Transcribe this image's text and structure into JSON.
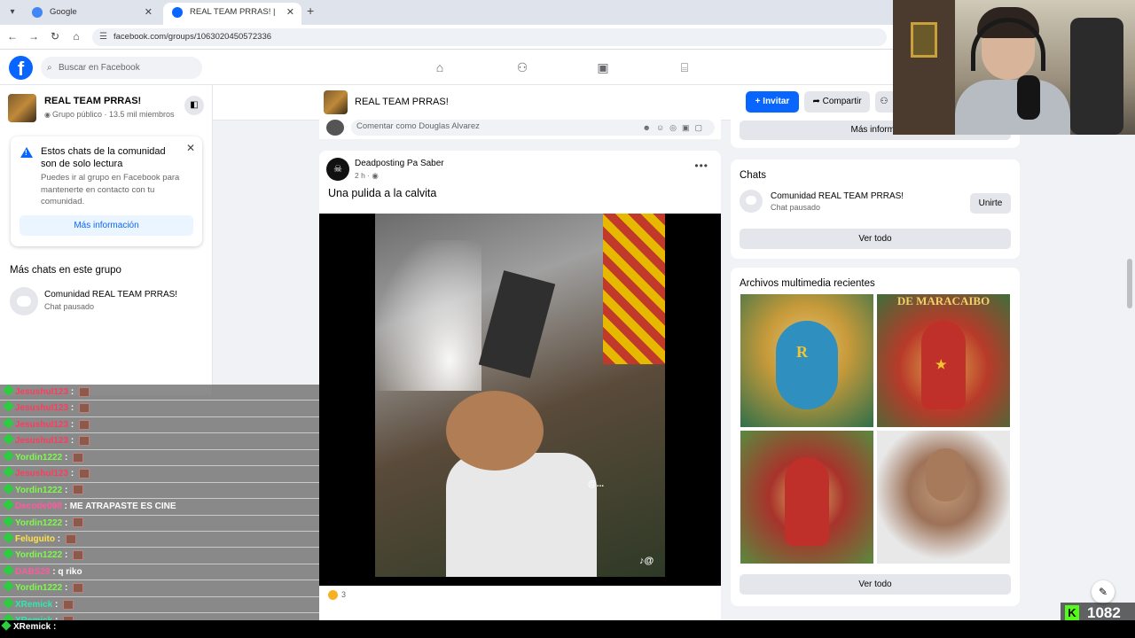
{
  "browser": {
    "tabs": [
      {
        "title": "Google",
        "favicon_color": "#4285f4"
      },
      {
        "title": "REAL TEAM PRRAS! | Facebook",
        "favicon_color": "#0866ff"
      }
    ],
    "new_tab": "+",
    "url": "facebook.com/groups/1063020450572336"
  },
  "facebook": {
    "logo": "f",
    "search_placeholder": "Buscar en Facebook",
    "nav_icons": [
      "home-icon",
      "friends-icon",
      "watch-icon",
      "marketplace-icon"
    ]
  },
  "sidebar": {
    "group_name": "REAL TEAM PRRAS!",
    "group_meta": "Grupo público · 13.5 mil miembros",
    "notice": {
      "title": "Estos chats de la comunidad son de solo lectura",
      "body": "Puedes ir al grupo en Facebook para mantenerte en contacto con tu comunidad.",
      "button": "Más información"
    },
    "more_chats_heading": "Más chats en este grupo",
    "chat": {
      "name": "Comunidad REAL TEAM PRRAS!",
      "status": "Chat pausado"
    }
  },
  "group_header": {
    "name": "REAL TEAM PRRAS!",
    "invite": "Invitar",
    "share": "Compartir"
  },
  "comment_box": {
    "placeholder": "Comentar como Douglas Alvarez"
  },
  "post": {
    "author": "Deadposting Pa Saber",
    "time": "2 h · ",
    "text": "Una pulida a la calvita",
    "video_watermark": "@...",
    "reactions": "3"
  },
  "right": {
    "top_button": "Más informa",
    "chats_title": "Chats",
    "chat": {
      "name": "Comunidad REAL TEAM PRRAS!",
      "status": "Chat pausado",
      "join": "Unirte"
    },
    "see_all": "Ver todo",
    "media_title": "Archivos multimedia recientes",
    "media": [
      {
        "caption": "",
        "emblem": "R"
      },
      {
        "caption": "DE MARACAIBO",
        "emblem": "★"
      },
      {
        "caption": "",
        "emblem": ""
      },
      {
        "caption": "",
        "emblem": ""
      }
    ],
    "media_see_all": "Ver todo"
  },
  "twitch_chat": [
    {
      "user": "Jesushul123",
      "color": "#ff3b5c",
      "message": ""
    },
    {
      "user": "Jesushul123",
      "color": "#ff3b5c",
      "message": ""
    },
    {
      "user": "Jesushul123",
      "color": "#ff3b5c",
      "message": ""
    },
    {
      "user": "Jesushul123",
      "color": "#ff3b5c",
      "message": ""
    },
    {
      "user": "Yordin1222",
      "color": "#7cfc4a",
      "message": ""
    },
    {
      "user": "Jesushul123",
      "color": "#ff3b5c",
      "message": ""
    },
    {
      "user": "Yordin1222",
      "color": "#7cfc4a",
      "message": ""
    },
    {
      "user": "Decode098",
      "color": "#ff5aa0",
      "message": "ME ATRAPASTE ES CINE"
    },
    {
      "user": "Yordin1222",
      "color": "#7cfc4a",
      "message": ""
    },
    {
      "user": "Feluguito",
      "color": "#ffe14a",
      "message": ""
    },
    {
      "user": "Yordin1222",
      "color": "#7cfc4a",
      "message": ""
    },
    {
      "user": "DABS29",
      "color": "#ff5aa0",
      "message": "q riko"
    },
    {
      "user": "Yordin1222",
      "color": "#7cfc4a",
      "message": ""
    },
    {
      "user": "XRemick",
      "color": "#33e6b0",
      "message": ""
    },
    {
      "user": "XRemick",
      "color": "#33e6b0",
      "message": ""
    }
  ],
  "twitch_last": "XRemick :",
  "viewer_count": "1082"
}
